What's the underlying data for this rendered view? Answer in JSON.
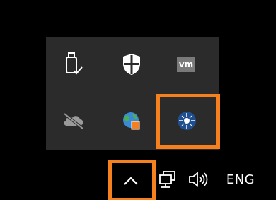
{
  "tray_popup": {
    "icons": [
      {
        "name": "usb-safely-remove-icon",
        "interactable": true
      },
      {
        "name": "windows-security-shield-icon",
        "interactable": true
      },
      {
        "name": "vmware-icon",
        "label": "vm",
        "interactable": true
      },
      {
        "name": "onedrive-offline-icon",
        "interactable": true
      },
      {
        "name": "globe-network-app-icon",
        "interactable": true
      },
      {
        "name": "blue-round-app-icon",
        "interactable": true
      }
    ]
  },
  "taskbar": {
    "chevron": "show-hidden-icons-chevron",
    "network": "network-icon",
    "volume": "speaker-volume-icon",
    "language": "ENG"
  },
  "colors": {
    "highlight": "#f7801e",
    "popup_bg": "#2b2b2b",
    "taskbar_bg": "#000000"
  }
}
